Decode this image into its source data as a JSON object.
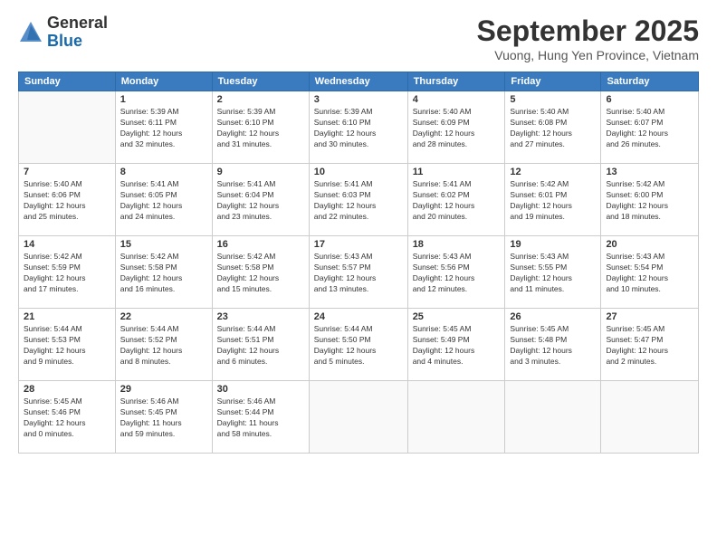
{
  "header": {
    "logo_line1": "General",
    "logo_line2": "Blue",
    "month_title": "September 2025",
    "location": "Vuong, Hung Yen Province, Vietnam"
  },
  "weekdays": [
    "Sunday",
    "Monday",
    "Tuesday",
    "Wednesday",
    "Thursday",
    "Friday",
    "Saturday"
  ],
  "weeks": [
    [
      {
        "day": "",
        "info": ""
      },
      {
        "day": "1",
        "info": "Sunrise: 5:39 AM\nSunset: 6:11 PM\nDaylight: 12 hours\nand 32 minutes."
      },
      {
        "day": "2",
        "info": "Sunrise: 5:39 AM\nSunset: 6:10 PM\nDaylight: 12 hours\nand 31 minutes."
      },
      {
        "day": "3",
        "info": "Sunrise: 5:39 AM\nSunset: 6:10 PM\nDaylight: 12 hours\nand 30 minutes."
      },
      {
        "day": "4",
        "info": "Sunrise: 5:40 AM\nSunset: 6:09 PM\nDaylight: 12 hours\nand 28 minutes."
      },
      {
        "day": "5",
        "info": "Sunrise: 5:40 AM\nSunset: 6:08 PM\nDaylight: 12 hours\nand 27 minutes."
      },
      {
        "day": "6",
        "info": "Sunrise: 5:40 AM\nSunset: 6:07 PM\nDaylight: 12 hours\nand 26 minutes."
      }
    ],
    [
      {
        "day": "7",
        "info": "Sunrise: 5:40 AM\nSunset: 6:06 PM\nDaylight: 12 hours\nand 25 minutes."
      },
      {
        "day": "8",
        "info": "Sunrise: 5:41 AM\nSunset: 6:05 PM\nDaylight: 12 hours\nand 24 minutes."
      },
      {
        "day": "9",
        "info": "Sunrise: 5:41 AM\nSunset: 6:04 PM\nDaylight: 12 hours\nand 23 minutes."
      },
      {
        "day": "10",
        "info": "Sunrise: 5:41 AM\nSunset: 6:03 PM\nDaylight: 12 hours\nand 22 minutes."
      },
      {
        "day": "11",
        "info": "Sunrise: 5:41 AM\nSunset: 6:02 PM\nDaylight: 12 hours\nand 20 minutes."
      },
      {
        "day": "12",
        "info": "Sunrise: 5:42 AM\nSunset: 6:01 PM\nDaylight: 12 hours\nand 19 minutes."
      },
      {
        "day": "13",
        "info": "Sunrise: 5:42 AM\nSunset: 6:00 PM\nDaylight: 12 hours\nand 18 minutes."
      }
    ],
    [
      {
        "day": "14",
        "info": "Sunrise: 5:42 AM\nSunset: 5:59 PM\nDaylight: 12 hours\nand 17 minutes."
      },
      {
        "day": "15",
        "info": "Sunrise: 5:42 AM\nSunset: 5:58 PM\nDaylight: 12 hours\nand 16 minutes."
      },
      {
        "day": "16",
        "info": "Sunrise: 5:42 AM\nSunset: 5:58 PM\nDaylight: 12 hours\nand 15 minutes."
      },
      {
        "day": "17",
        "info": "Sunrise: 5:43 AM\nSunset: 5:57 PM\nDaylight: 12 hours\nand 13 minutes."
      },
      {
        "day": "18",
        "info": "Sunrise: 5:43 AM\nSunset: 5:56 PM\nDaylight: 12 hours\nand 12 minutes."
      },
      {
        "day": "19",
        "info": "Sunrise: 5:43 AM\nSunset: 5:55 PM\nDaylight: 12 hours\nand 11 minutes."
      },
      {
        "day": "20",
        "info": "Sunrise: 5:43 AM\nSunset: 5:54 PM\nDaylight: 12 hours\nand 10 minutes."
      }
    ],
    [
      {
        "day": "21",
        "info": "Sunrise: 5:44 AM\nSunset: 5:53 PM\nDaylight: 12 hours\nand 9 minutes."
      },
      {
        "day": "22",
        "info": "Sunrise: 5:44 AM\nSunset: 5:52 PM\nDaylight: 12 hours\nand 8 minutes."
      },
      {
        "day": "23",
        "info": "Sunrise: 5:44 AM\nSunset: 5:51 PM\nDaylight: 12 hours\nand 6 minutes."
      },
      {
        "day": "24",
        "info": "Sunrise: 5:44 AM\nSunset: 5:50 PM\nDaylight: 12 hours\nand 5 minutes."
      },
      {
        "day": "25",
        "info": "Sunrise: 5:45 AM\nSunset: 5:49 PM\nDaylight: 12 hours\nand 4 minutes."
      },
      {
        "day": "26",
        "info": "Sunrise: 5:45 AM\nSunset: 5:48 PM\nDaylight: 12 hours\nand 3 minutes."
      },
      {
        "day": "27",
        "info": "Sunrise: 5:45 AM\nSunset: 5:47 PM\nDaylight: 12 hours\nand 2 minutes."
      }
    ],
    [
      {
        "day": "28",
        "info": "Sunrise: 5:45 AM\nSunset: 5:46 PM\nDaylight: 12 hours\nand 0 minutes."
      },
      {
        "day": "29",
        "info": "Sunrise: 5:46 AM\nSunset: 5:45 PM\nDaylight: 11 hours\nand 59 minutes."
      },
      {
        "day": "30",
        "info": "Sunrise: 5:46 AM\nSunset: 5:44 PM\nDaylight: 11 hours\nand 58 minutes."
      },
      {
        "day": "",
        "info": ""
      },
      {
        "day": "",
        "info": ""
      },
      {
        "day": "",
        "info": ""
      },
      {
        "day": "",
        "info": ""
      }
    ]
  ]
}
